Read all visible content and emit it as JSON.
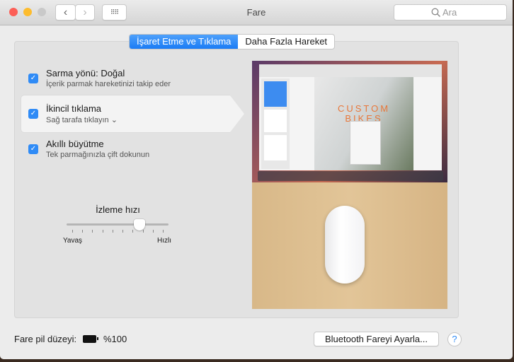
{
  "window": {
    "title": "Fare",
    "search_placeholder": "Ara"
  },
  "tabs": [
    {
      "label": "İşaret Etme ve Tıklama",
      "selected": true
    },
    {
      "label": "Daha Fazla Hareket",
      "selected": false
    }
  ],
  "options": [
    {
      "label": "Sarma yönü: Doğal",
      "sub": "İçerik parmak hareketinizi takip eder",
      "checked": true
    },
    {
      "label": "İkincil tıklama",
      "sub": "Sağ tarafa tıklayın",
      "checked": true
    },
    {
      "label": "Akıllı büyütme",
      "sub": "Tek parmağınızla çift dokunun",
      "checked": true
    }
  ],
  "tracking": {
    "label": "İzleme hızı",
    "min_label": "Yavaş",
    "max_label": "Hızlı",
    "value": 0.74,
    "ticks": 10
  },
  "preview": {
    "headline": "CUSTOM BIKES"
  },
  "footer": {
    "battery_label": "Fare pil düzeyi:",
    "battery_value": "%100",
    "setup_button": "Bluetooth Fareyi Ayarla...",
    "help": "?"
  },
  "colors": {
    "accent": "#1a7cf5"
  }
}
